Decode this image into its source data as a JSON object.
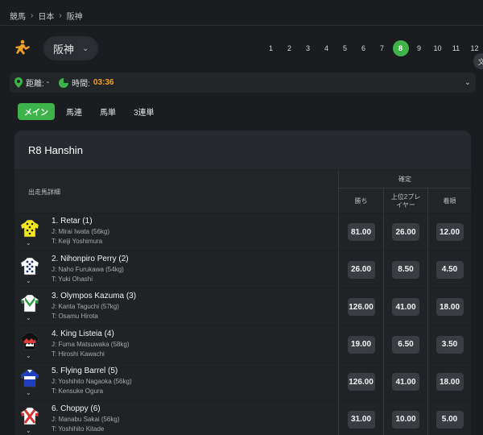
{
  "breadcrumb": [
    "競馬",
    "日本",
    "阪神"
  ],
  "venue": {
    "selected": "阪神"
  },
  "race_numbers": [
    "1",
    "2",
    "3",
    "4",
    "5",
    "6",
    "7",
    "8",
    "9",
    "10",
    "11",
    "12"
  ],
  "active_race": "8",
  "language_button": "文",
  "info": {
    "distance_label": "距離:",
    "distance_value": "-",
    "time_label": "時間:",
    "time_value": "03:36"
  },
  "tabs": [
    "メイン",
    "馬連",
    "馬単",
    "3連単"
  ],
  "race_title": "R8 Hanshin",
  "table": {
    "detail_header": "出走馬詳細",
    "group_header": "確定",
    "columns": [
      "勝ち",
      "上位2プレイヤー",
      "着順"
    ]
  },
  "runners": [
    {
      "name": "1. Retar (1)",
      "jockey": "J: Mirai Iwata (56kg)",
      "trainer": "T: Keiji Yoshimura",
      "odds": [
        "81.00",
        "26.00",
        "12.00"
      ],
      "silk": "yellow-dots"
    },
    {
      "name": "2. Nihonpiro Perry (2)",
      "jockey": "J: Naho Furukawa (54kg)",
      "trainer": "T: Yuki Ohashi",
      "odds": [
        "26.00",
        "8.50",
        "4.50"
      ],
      "silk": "white-navy-dots"
    },
    {
      "name": "3. Olympos Kazuma (3)",
      "jockey": "J: Kanta Taguchi (57kg)",
      "trainer": "T: Osamu Hirota",
      "odds": [
        "126.00",
        "41.00",
        "18.00"
      ],
      "silk": "white-green"
    },
    {
      "name": "4. King Listeia (4)",
      "jockey": "J: Fuma Matsuwaka (58kg)",
      "trainer": "T: Hiroshi Kawachi",
      "odds": [
        "19.00",
        "6.50",
        "3.50"
      ],
      "silk": "black-red"
    },
    {
      "name": "5. Flying Barrel (5)",
      "jockey": "J: Yoshihito Nagaoka (56kg)",
      "trainer": "T: Kensuke Ogura",
      "odds": [
        "126.00",
        "41.00",
        "18.00"
      ],
      "silk": "blue-white"
    },
    {
      "name": "6. Choppy (6)",
      "jockey": "J: Manabu Sakai (56kg)",
      "trainer": "T: Yoshihito Kitade",
      "odds": [
        "31.00",
        "10.00",
        "5.00"
      ],
      "silk": "white-red-cross"
    }
  ]
}
